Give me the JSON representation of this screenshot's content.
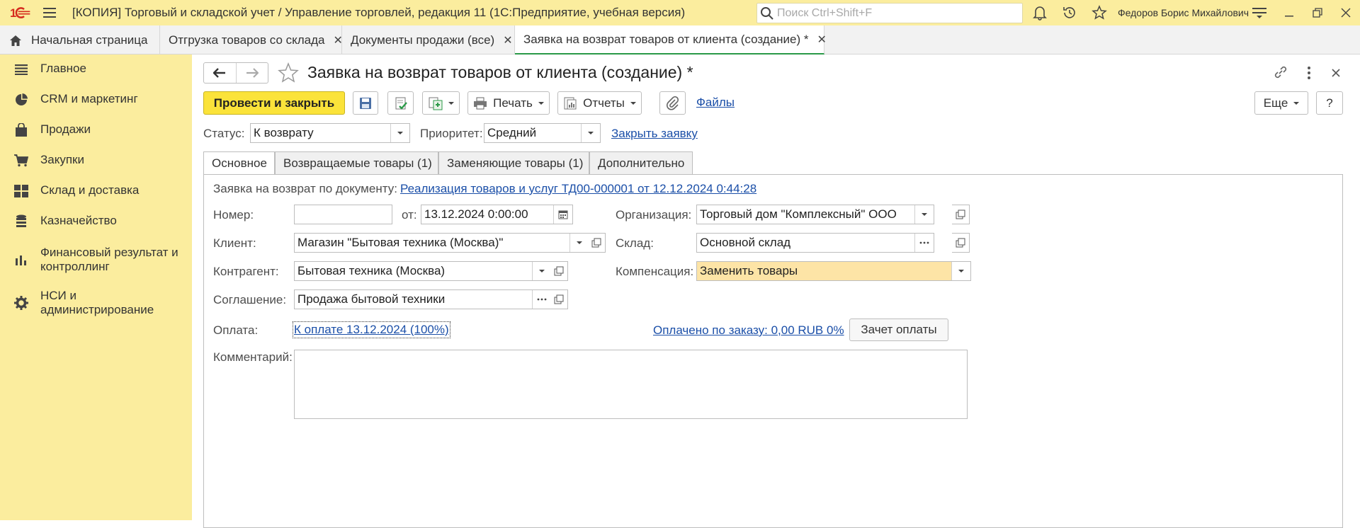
{
  "titlebar": {
    "title": "[КОПИЯ] Торговый и складской учет / Управление торговлей, редакция 11  (1С:Предприятие, учебная версия)",
    "search_placeholder": "Поиск Ctrl+Shift+F",
    "username": "Федоров Борис Михайлович",
    "brand_color": "#fbed9e",
    "logo_color": "#d52b1e"
  },
  "tabs": [
    {
      "label": "Начальная страница"
    },
    {
      "label": "Отгрузка товаров со склада"
    },
    {
      "label": "Документы продажи (все)"
    },
    {
      "label": "Заявка на возврат товаров от клиента (создание) *"
    }
  ],
  "sidebar": {
    "items": [
      {
        "label": "Главное",
        "icon": "list-icon"
      },
      {
        "label": "CRM и маркетинг",
        "icon": "pie-chart-icon"
      },
      {
        "label": "Продажи",
        "icon": "shopping-bag-icon"
      },
      {
        "label": "Закупки",
        "icon": "cart-icon"
      },
      {
        "label": "Склад и доставка",
        "icon": "warehouse-icon"
      },
      {
        "label": "Казначейство",
        "icon": "coins-icon"
      },
      {
        "label": "Финансовый результат и контроллинг",
        "icon": "bar-chart-icon"
      },
      {
        "label": "НСИ и администрирование",
        "icon": "gear-icon"
      }
    ]
  },
  "document": {
    "title": "Заявка на возврат товаров от клиента (создание) *"
  },
  "toolbar": {
    "post_close": "Провести и закрыть",
    "print": "Печать",
    "reports": "Отчеты",
    "files": "Файлы",
    "more": "Еще",
    "help": "?"
  },
  "status_row": {
    "status_label": "Статус:",
    "status_value": "К возврату",
    "priority_label": "Приоритет:",
    "priority_value": "Средний",
    "close_link": "Закрыть заявку"
  },
  "form_tabs": [
    {
      "label": "Основное"
    },
    {
      "label": "Возвращаемые товары (1)"
    },
    {
      "label": "Заменяющие товары (1)"
    },
    {
      "label": "Дополнительно"
    }
  ],
  "form": {
    "basis_label": "Заявка на возврат по документу:",
    "basis_link": "Реализация товаров и услуг ТД00-000001 от 12.12.2024 0:44:28",
    "number_label": "Номер:",
    "number_value": "",
    "date_label": "от:",
    "date_value": "13.12.2024  0:00:00",
    "org_label": "Организация:",
    "org_value": "Торговый дом \"Комплексный\" ООО",
    "client_label": "Клиент:",
    "client_value": "Магазин \"Бытовая техника (Москва)\"",
    "warehouse_label": "Склад:",
    "warehouse_value": "Основной склад",
    "counterparty_label": "Контрагент:",
    "counterparty_value": "Бытовая техника (Москва)",
    "compensation_label": "Компенсация:",
    "compensation_value": "Заменить товары",
    "agreement_label": "Соглашение:",
    "agreement_value": "Продажа бытовой техники",
    "payment_label": "Оплата:",
    "payment_link": "К оплате 13.12.2024 (100%)",
    "paid_link": "Оплачено по заказу: 0,00 RUB 0%",
    "offset_button": "Зачет оплаты",
    "comment_label": "Комментарий:",
    "comment_value": ""
  }
}
